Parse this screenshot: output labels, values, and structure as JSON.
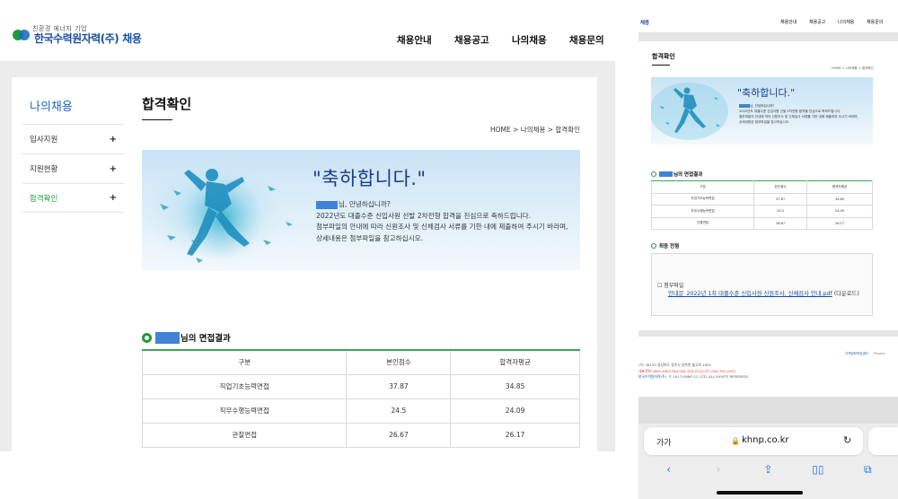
{
  "header": {
    "logo_sub": "친환경 에너지 기업",
    "logo_name": "한국수력원자력(주)",
    "logo_suffix": "채용",
    "nav": [
      "채용안내",
      "채용공고",
      "나의채용",
      "채용문의"
    ]
  },
  "sidebar": {
    "title": "나의채용",
    "items": [
      {
        "label": "입사지원",
        "icon": "plus-icon",
        "active": false
      },
      {
        "label": "지원현황",
        "icon": "plus-icon",
        "active": false
      },
      {
        "label": "합격확인",
        "icon": "plus-icon",
        "active": true
      }
    ]
  },
  "main": {
    "title": "합격확인",
    "breadcrumb": "HOME > 나의채용 > 합격확인",
    "banner": {
      "headline": "\"축하합니다.\"",
      "line1_suffix": "님, 안녕하십니까?",
      "line2": "2022년도 대졸수준 신입사원 선발 2차전형 합격을 진심으로 축하드립니다.",
      "line3": "첨부파일의 안내에 따라 신원조사 및 신체검사 서류를 기한 내에 제출하여 주시기 바라며,",
      "line4": "상세내용은 첨부파일을 참고하십시오."
    },
    "result_section": "님의 면접결과",
    "table": {
      "headers": [
        "구분",
        "본인점수",
        "합격자평균"
      ],
      "rows": [
        [
          "직업기초능력면접",
          "37.87",
          "34.85"
        ],
        [
          "직무수행능력면접",
          "24.5",
          "24.09"
        ],
        [
          "관찰면접",
          "26.67",
          "26.17"
        ]
      ]
    }
  },
  "mobile": {
    "logo": "채용",
    "nav": [
      "채용안내",
      "채용공고",
      "나의채용",
      "채용문의"
    ],
    "title": "합격확인",
    "breadcrumb": "HOME > 나의채용 > 합격확인",
    "headline": "\"축하합니다.\"",
    "final_section": "최종 전형",
    "attachment_label": "첨부파일",
    "attachment_link": "안내문_2022년 1차 대졸수준 신입사원 신원조사, 신체검사 안내.pdf",
    "attachment_suffix": "(다운로드)",
    "footer_links": [
      "고객정보보호센터",
      "Privacy"
    ],
    "footer_address": "(우) 38120 경상북도 경주시 양북면 불국로 1655",
    "footer_phone": "대표전화 1600-4000  FAX 054-704-2214  (우) 054-704-2203",
    "footer_company": "한국수력원자력(주)",
    "footer_copyright": "© 2017 KHNP CO.,LTD. ALL RIGHTS RESERVED.",
    "browser": {
      "text_size": "가가",
      "domain": "khnp.co.kr"
    }
  },
  "colors": {
    "brand_blue": "#1a4fa0",
    "accent_green": "#1e9b3a",
    "mask_blue": "#3f82d8"
  }
}
